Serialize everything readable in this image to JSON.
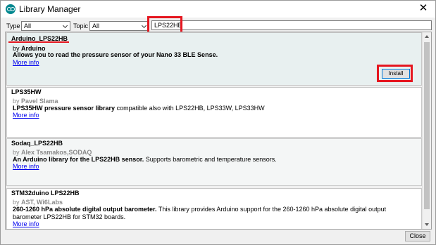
{
  "window": {
    "title": "Library Manager",
    "close_glyph": "✕"
  },
  "filters": {
    "type_label": "Type",
    "type_value": "All",
    "topic_label": "Topic",
    "topic_value": "All",
    "search_value": "LPS22HB"
  },
  "libraries": [
    {
      "name": "Arduino_LPS22HB",
      "by_prefix": "by ",
      "author": "Arduino",
      "desc_bold": "Allows you to read the pressure sensor of your Nano 33 BLE Sense.",
      "desc_rest": "",
      "more_info": "More info",
      "install_label": "Install"
    },
    {
      "name": "LPS35HW",
      "by_prefix": "by ",
      "author": "Pavel Slama",
      "desc_bold": "LPS35HW pressure sensor library",
      "desc_rest": " compatible also with LPS22HB, LPS33W, LPS33HW",
      "more_info": "More info"
    },
    {
      "name": "Sodaq_LPS22HB",
      "by_prefix": "by ",
      "author": "Alex Tsamakos,SODAQ",
      "desc_bold": "An Arduino library for the LPS22HB sensor.",
      "desc_rest": " Supports barometric and temperature sensors.",
      "more_info": "More info"
    },
    {
      "name": "STM32duino LPS22HB",
      "by_prefix": "by ",
      "author": "AST, Wi6Labs",
      "desc_bold": "260-1260 hPa absolute digital output barometer.",
      "desc_rest": " This library provides Arduino support for the 260-1260 hPa absolute digital output barometer LPS22HB for STM32 boards.",
      "more_info": "More info"
    }
  ],
  "footer": {
    "close_label": "Close"
  },
  "colors": {
    "highlight": "#e5161f",
    "link": "#0000ee",
    "accent": "#00878f"
  },
  "icons": {
    "app": "arduino-logo-icon",
    "close": "close-icon",
    "dropdown": "chevron-down-icon"
  }
}
